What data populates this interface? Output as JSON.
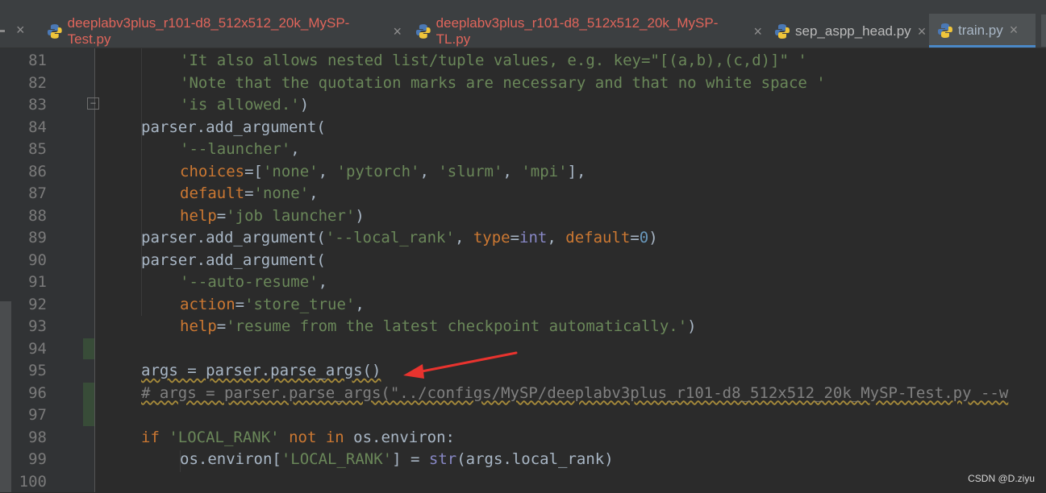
{
  "tabs": [
    {
      "label": "deeplabv3plus_r101-d8_512x512_20k_MySP-Test.py",
      "close": "×",
      "state": "modified"
    },
    {
      "label": "deeplabv3plus_r101-d8_512x512_20k_MySP-TL.py",
      "close": "×",
      "state": "modified"
    },
    {
      "label": "sep_aspp_head.py",
      "close": "×",
      "state": "normal"
    },
    {
      "label": "train.py",
      "close": "×",
      "state": "active"
    }
  ],
  "left_close": "×",
  "fold_glyph": "−",
  "line_numbers": [
    "81",
    "82",
    "83",
    "84",
    "85",
    "86",
    "87",
    "88",
    "89",
    "90",
    "91",
    "92",
    "93",
    "94",
    "95",
    "96",
    "97",
    "98",
    "99",
    "100"
  ],
  "code": {
    "l81": "'It also allows nested list/tuple values, e.g. key=\"[(a,b),(c,d)]\" '",
    "l82": "'Note that the quotation marks are necessary and that no white space '",
    "l83_str": "'is allowed.'",
    "l83_end": ")",
    "l84": "parser.add_argument(",
    "l85_str": "'--launcher'",
    "l85_end": ",",
    "l86_kw": "choices",
    "l86_a": "=[",
    "l86_s1": "'none'",
    "l86_c1": ", ",
    "l86_s2": "'pytorch'",
    "l86_c2": ", ",
    "l86_s3": "'slurm'",
    "l86_c3": ", ",
    "l86_s4": "'mpi'",
    "l86_end": "],",
    "l87_kw": "default",
    "l87_eq": "=",
    "l87_s": "'none'",
    "l87_end": ",",
    "l88_kw": "help",
    "l88_eq": "=",
    "l88_s": "'job launcher'",
    "l88_end": ")",
    "l89_a": "parser.add_argument(",
    "l89_s": "'--local_rank'",
    "l89_c": ", ",
    "l89_kw1": "type",
    "l89_eq1": "=",
    "l89_b": "int",
    "l89_c2": ", ",
    "l89_kw2": "default",
    "l89_eq2": "=",
    "l89_n": "0",
    "l89_end": ")",
    "l90": "parser.add_argument(",
    "l91_s": "'--auto-resume'",
    "l91_end": ",",
    "l92_kw": "action",
    "l92_eq": "=",
    "l92_s": "'store_true'",
    "l92_end": ",",
    "l93_kw": "help",
    "l93_eq": "=",
    "l93_s": "'resume from the latest checkpoint automatically.'",
    "l93_end": ")",
    "l95": "args = parser.parse_args()",
    "l96": "# args = parser.parse_args(\"../configs/MySP/deeplabv3plus_r101-d8_512x512_20k_MySP-Test.py --w",
    "l98_if": "if",
    "l98_s": "'LOCAL_RANK'",
    "l98_sp": " ",
    "l98_notin": "not in",
    "l98_end": " os.environ:",
    "l99_a": "os.environ[",
    "l99_s": "'LOCAL_RANK'",
    "l99_b1": "] = ",
    "l99_str": "str",
    "l99_end": "(args.local_rank)"
  },
  "watermark": "CSDN @D.ziyu",
  "colors": {
    "background": "#2b2b2b",
    "keyword": "#cc7832",
    "string": "#6a8759",
    "number": "#6897bb",
    "builtin": "#8888c6",
    "comment": "#808080",
    "modified_tab": "#e0655b",
    "active_tab_underline": "#4a88c7",
    "arrow": "#e8332e"
  }
}
